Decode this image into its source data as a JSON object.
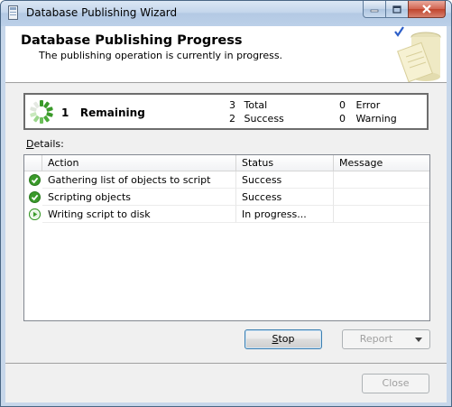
{
  "window": {
    "title": "Database Publishing Wizard",
    "minimize_glyph": "─",
    "maximize_glyph": "□",
    "close_glyph": "✕"
  },
  "header": {
    "title": "Database Publishing Progress",
    "subtitle": "The publishing operation is currently in progress."
  },
  "summary": {
    "remaining_count": "1",
    "remaining_label": "Remaining",
    "total_count": "3",
    "total_label": "Total",
    "success_count": "2",
    "success_label": "Success",
    "error_count": "0",
    "error_label": "Error",
    "warning_count": "0",
    "warning_label": "Warning"
  },
  "details": {
    "label_prefix": "D",
    "label_rest": "etails:",
    "columns": [
      "Action",
      "Status",
      "Message"
    ],
    "rows": [
      {
        "action": "Gathering list of objects to script",
        "status": "Success",
        "message": "",
        "icon": "success-check-icon"
      },
      {
        "action": "Scripting objects",
        "status": "Success",
        "message": "",
        "icon": "success-check-icon"
      },
      {
        "action": "Writing script to disk",
        "status": "In progress...",
        "message": "",
        "icon": "in-progress-icon"
      }
    ]
  },
  "buttons": {
    "stop_prefix": "S",
    "stop_rest": "top",
    "report": "Report",
    "close": "Close"
  },
  "colors": {
    "success_green": "#3a9a2a",
    "accent_blue": "#3c7fb1"
  }
}
